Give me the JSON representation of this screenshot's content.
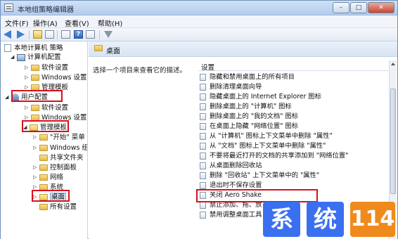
{
  "window": {
    "title": "本地组策略编辑器",
    "controls": {
      "minimize": "–",
      "maximize": "□",
      "close": "✕"
    }
  },
  "menu": [
    "文件(F)",
    "操作(A)",
    "查看(V)",
    "帮助(H)"
  ],
  "toolbar": [
    "back-icon",
    "forward-icon",
    "up-icon",
    "show-tree-icon",
    "export-icon",
    "help-icon",
    "properties-icon",
    "filter-icon"
  ],
  "tree": {
    "root": "本地计算机 策略",
    "computer_config": "计算机配置",
    "computer_children": [
      "软件设置",
      "Windows 设置",
      "管理模板"
    ],
    "user_config": "用户配置",
    "user_children": [
      "软件设置",
      "Windows 设置",
      "管理模板"
    ],
    "admin_children": [
      "\"开始\" 菜单",
      "Windows 组",
      "共享文件夹",
      "控制面板",
      "网络",
      "系统",
      "桌面",
      "所有设置"
    ]
  },
  "panel": {
    "header_title": "桌面",
    "description": "选择一个项目来查看它的描述。",
    "column_header": "设置",
    "items": [
      "隐藏和禁用桌面上的所有项目",
      "删除清理桌面向导",
      "隐藏桌面上的 Internet Explorer 图标",
      "删除桌面上的 \"计算机\" 图标",
      "删除桌面上的 \"我的文档\" 图标",
      "在桌面上隐藏 \"网络位置\" 图标",
      "从 \"计算机\" 图标上下文菜单中删除 \"属性\"",
      "从 \"文档\" 图标上下文菜单中删除 \"属性\"",
      "不要将最近打开的文档的共享添加到 \"网络位置\"",
      "从桌面删除回收站",
      "删除 \"回收站\" 上下文菜单中的 \"属性\"",
      "退出时不保存设置",
      "关闭 Aero Shake",
      "禁止添加、拖、放",
      "禁用调整桌面工具"
    ]
  },
  "watermark": [
    "系",
    "统",
    "114"
  ],
  "colors": {
    "highlight_box": "#d8101f",
    "watermark_blue": "#3a6ff0",
    "watermark_orange": "#f08a1c"
  }
}
